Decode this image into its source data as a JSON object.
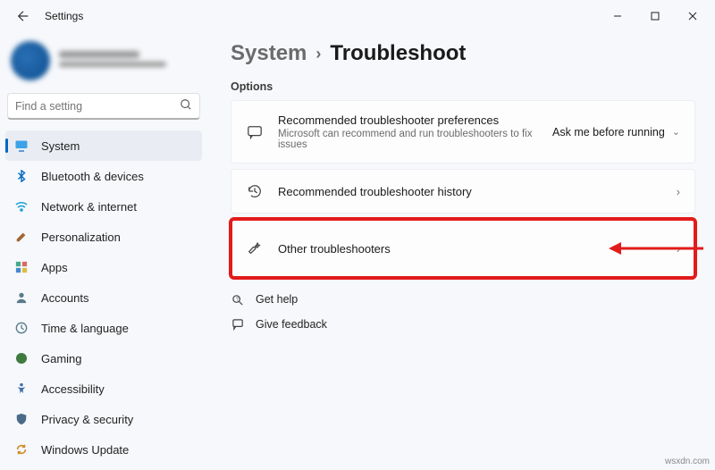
{
  "window": {
    "title": "Settings"
  },
  "user": {
    "name_placeholder": "———",
    "email_placeholder": "———"
  },
  "search": {
    "placeholder": "Find a setting"
  },
  "sidebar": {
    "items": [
      {
        "label": "System",
        "icon": "monitor-icon",
        "selected": true
      },
      {
        "label": "Bluetooth & devices",
        "icon": "bluetooth-icon",
        "selected": false
      },
      {
        "label": "Network & internet",
        "icon": "wifi-icon",
        "selected": false
      },
      {
        "label": "Personalization",
        "icon": "paint-icon",
        "selected": false
      },
      {
        "label": "Apps",
        "icon": "apps-icon",
        "selected": false
      },
      {
        "label": "Accounts",
        "icon": "account-icon",
        "selected": false
      },
      {
        "label": "Time & language",
        "icon": "clock-icon",
        "selected": false
      },
      {
        "label": "Gaming",
        "icon": "gaming-icon",
        "selected": false
      },
      {
        "label": "Accessibility",
        "icon": "access-icon",
        "selected": false
      },
      {
        "label": "Privacy & security",
        "icon": "shield-icon",
        "selected": false
      },
      {
        "label": "Windows Update",
        "icon": "update-icon",
        "selected": false
      }
    ]
  },
  "breadcrumb": {
    "parent": "System",
    "current": "Troubleshoot"
  },
  "section": {
    "heading": "Options"
  },
  "cards": {
    "recommended_prefs": {
      "title": "Recommended troubleshooter preferences",
      "desc": "Microsoft can recommend and run troubleshooters to fix issues",
      "value": "Ask me before running"
    },
    "history": {
      "title": "Recommended troubleshooter history"
    },
    "other": {
      "title": "Other troubleshooters"
    }
  },
  "footer": {
    "help": "Get help",
    "feedback": "Give feedback"
  },
  "watermark": "wsxdn.com"
}
